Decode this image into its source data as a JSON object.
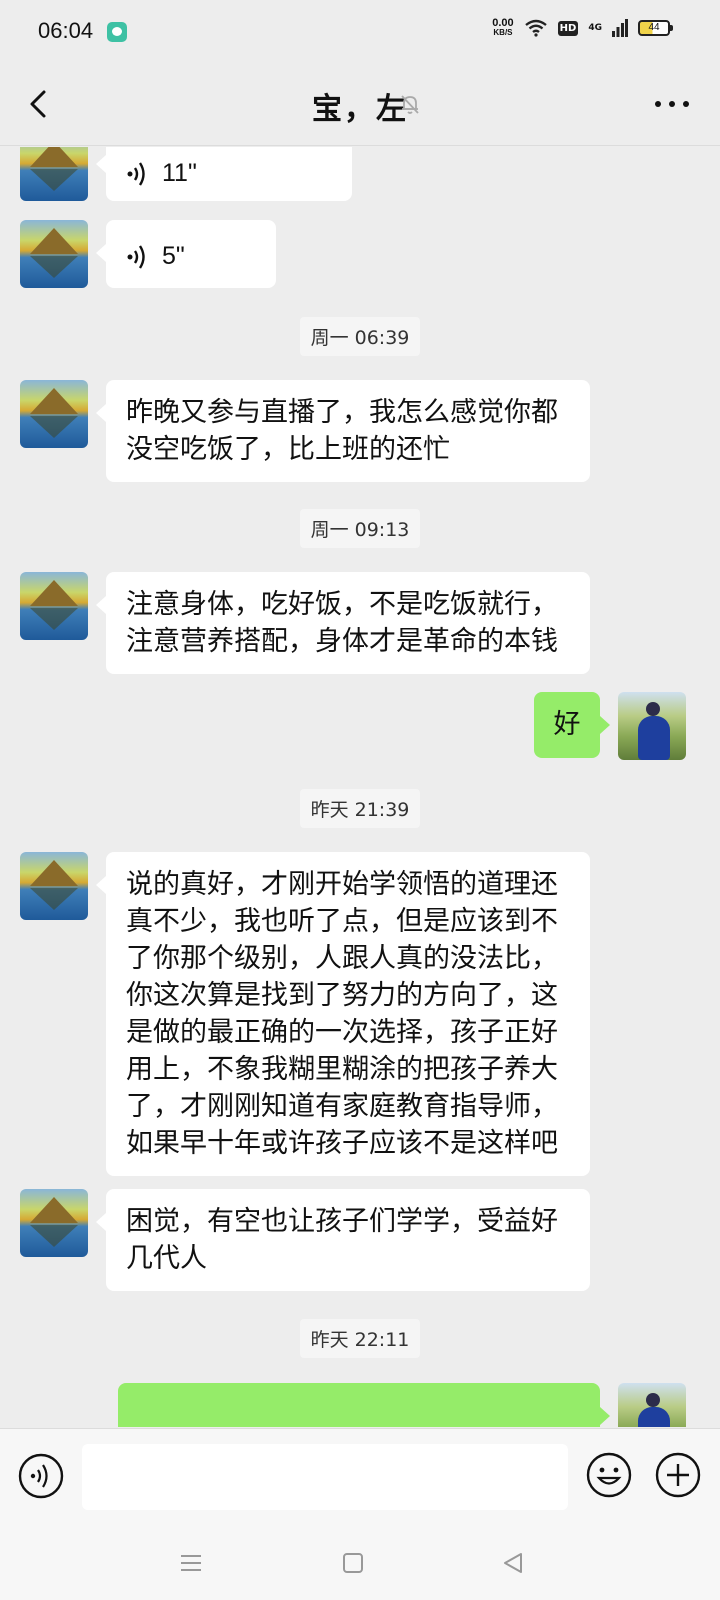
{
  "status_bar": {
    "time": "06:04",
    "net_speed": "0.00",
    "net_unit": "KB/S",
    "hd": "HD",
    "network": "4G",
    "battery": "44"
  },
  "header": {
    "title": "宝，左"
  },
  "messages": [
    {
      "kind": "voice",
      "side": "left",
      "duration": "11\""
    },
    {
      "kind": "voice",
      "side": "left",
      "duration": "5\""
    },
    {
      "kind": "time",
      "text": "周一 06:39"
    },
    {
      "kind": "text",
      "side": "left",
      "lines": [
        "昨晚又参与直播了，我怎么感觉你都",
        "没空吃饭了，比上班的还忙"
      ]
    },
    {
      "kind": "time",
      "text": "周一 09:13"
    },
    {
      "kind": "text",
      "side": "left",
      "lines": [
        "注意身体，吃好饭，不是吃饭就行，",
        "注意营养搭配，身体才是革命的本钱"
      ]
    },
    {
      "kind": "text",
      "side": "right",
      "lines": [
        "好"
      ]
    },
    {
      "kind": "time",
      "text": "昨天 21:39"
    },
    {
      "kind": "text",
      "side": "left",
      "lines": [
        "说的真好，才刚开始学领悟的道理还",
        "真不少，我也听了点，但是应该到不",
        "了你那个级别，人跟人真的没法比，",
        "你这次算是找到了努力的方向了，这",
        "是做的最正确的一次选择，孩子正好",
        "用上，不象我糊里糊涂的把孩子养大",
        "了，才刚刚知道有家庭教育指导师，",
        "如果早十年或许孩子应该不是这样吧"
      ]
    },
    {
      "kind": "text",
      "side": "left",
      "lines": [
        "困觉，有空也让孩子们学学，受益好",
        "几代人"
      ]
    },
    {
      "kind": "time",
      "text": "昨天 22:11"
    }
  ],
  "input": {
    "value": "",
    "placeholder": ""
  },
  "colors": {
    "background": "#ededed",
    "bubble_self": "#95ec69",
    "bubble_other": "#ffffff"
  },
  "icons": [
    "back-arrow-icon",
    "mute-bell-icon",
    "more-dots-icon",
    "voice-wave-icon",
    "emoji-icon",
    "plus-icon",
    "menu-icon",
    "home-square-icon",
    "back-triangle-icon"
  ]
}
